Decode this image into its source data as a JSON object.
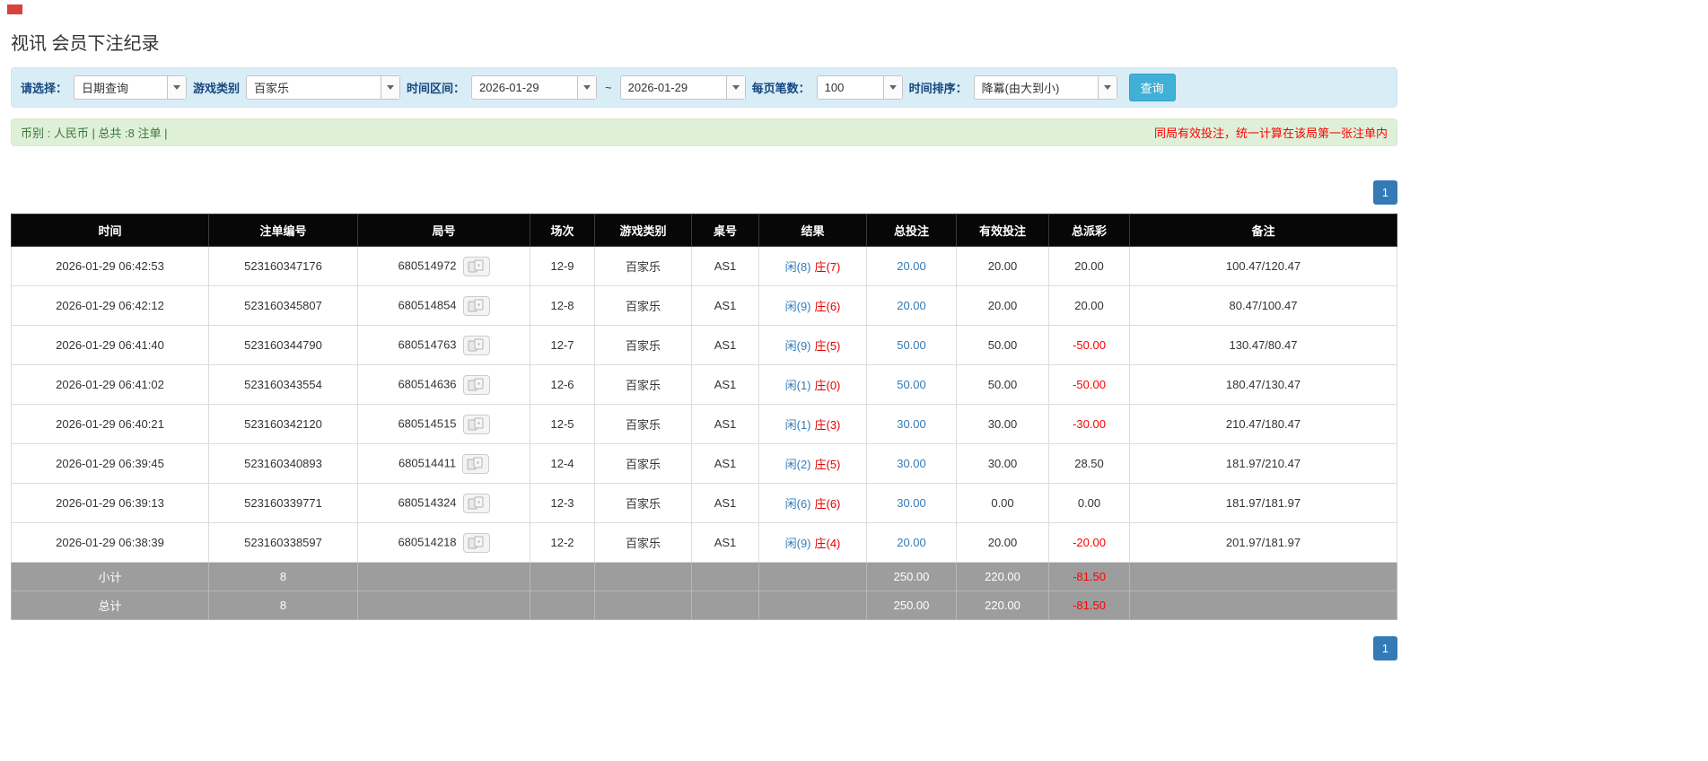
{
  "page": {
    "title": "视讯 会员下注纪录"
  },
  "filters": {
    "select_label": "请选择：",
    "select_value": "日期查询",
    "game_type_label": "游戏类别",
    "game_type_value": "百家乐",
    "date_range_label": "时间区间：",
    "date_from": "2026-01-29",
    "date_separator": "~",
    "date_to": "2026-01-29",
    "page_size_label": "每页笔数：",
    "page_size_value": "100",
    "sort_label": "时间排序：",
    "sort_value": "降冪(由大到小)",
    "search_button": "查询"
  },
  "summary": {
    "left": "币别 : 人民币 | 总共 :8 注单 |",
    "right": "同局有效投注，统一计算在该局第一张注单内"
  },
  "pagination": {
    "page": "1"
  },
  "colors": {
    "header_bg": "#070707",
    "footer_bg": "#9d9d9d",
    "filter_bg": "#d9edf7",
    "summary_bg": "#dff0d8",
    "accent_blue": "#337ab7",
    "button_teal": "#41b0d5",
    "player_blue": "#337ab7",
    "banker_red": "#e60000",
    "negative_red": "#ff0000"
  },
  "table": {
    "headers": [
      "时间",
      "注单编号",
      "局号",
      "场次",
      "游戏类别",
      "桌号",
      "结果",
      "总投注",
      "有效投注",
      "总派彩",
      "备注"
    ],
    "rows": [
      {
        "time": "2026-01-29 06:42:53",
        "bet_id": "523160347176",
        "round_id": "680514972",
        "session": "12-9",
        "game": "百家乐",
        "table_no": "AS1",
        "result_player": "闲(8)",
        "result_banker": "庄(7)",
        "total_bet": "20.00",
        "valid_bet": "20.00",
        "payout": "20.00",
        "remark": "100.47/120.47"
      },
      {
        "time": "2026-01-29 06:42:12",
        "bet_id": "523160345807",
        "round_id": "680514854",
        "session": "12-8",
        "game": "百家乐",
        "table_no": "AS1",
        "result_player": "闲(9)",
        "result_banker": "庄(6)",
        "total_bet": "20.00",
        "valid_bet": "20.00",
        "payout": "20.00",
        "remark": "80.47/100.47"
      },
      {
        "time": "2026-01-29 06:41:40",
        "bet_id": "523160344790",
        "round_id": "680514763",
        "session": "12-7",
        "game": "百家乐",
        "table_no": "AS1",
        "result_player": "闲(9)",
        "result_banker": "庄(5)",
        "total_bet": "50.00",
        "valid_bet": "50.00",
        "payout": "-50.00",
        "remark": "130.47/80.47"
      },
      {
        "time": "2026-01-29 06:41:02",
        "bet_id": "523160343554",
        "round_id": "680514636",
        "session": "12-6",
        "game": "百家乐",
        "table_no": "AS1",
        "result_player": "闲(1)",
        "result_banker": "庄(0)",
        "total_bet": "50.00",
        "valid_bet": "50.00",
        "payout": "-50.00",
        "remark": "180.47/130.47"
      },
      {
        "time": "2026-01-29 06:40:21",
        "bet_id": "523160342120",
        "round_id": "680514515",
        "session": "12-5",
        "game": "百家乐",
        "table_no": "AS1",
        "result_player": "闲(1)",
        "result_banker": "庄(3)",
        "total_bet": "30.00",
        "valid_bet": "30.00",
        "payout": "-30.00",
        "remark": "210.47/180.47"
      },
      {
        "time": "2026-01-29 06:39:45",
        "bet_id": "523160340893",
        "round_id": "680514411",
        "session": "12-4",
        "game": "百家乐",
        "table_no": "AS1",
        "result_player": "闲(2)",
        "result_banker": "庄(5)",
        "total_bet": "30.00",
        "valid_bet": "30.00",
        "payout": "28.50",
        "remark": "181.97/210.47"
      },
      {
        "time": "2026-01-29 06:39:13",
        "bet_id": "523160339771",
        "round_id": "680514324",
        "session": "12-3",
        "game": "百家乐",
        "table_no": "AS1",
        "result_player": "闲(6)",
        "result_banker": "庄(6)",
        "total_bet": "30.00",
        "valid_bet": "0.00",
        "payout": "0.00",
        "remark": "181.97/181.97"
      },
      {
        "time": "2026-01-29 06:38:39",
        "bet_id": "523160338597",
        "round_id": "680514218",
        "session": "12-2",
        "game": "百家乐",
        "table_no": "AS1",
        "result_player": "闲(9)",
        "result_banker": "庄(4)",
        "total_bet": "20.00",
        "valid_bet": "20.00",
        "payout": "-20.00",
        "remark": "201.97/181.97"
      }
    ],
    "subtotal": {
      "label": "小计",
      "count": "8",
      "total_bet": "250.00",
      "valid_bet": "220.00",
      "payout": "-81.50"
    },
    "total": {
      "label": "总计",
      "count": "8",
      "total_bet": "250.00",
      "valid_bet": "220.00",
      "payout": "-81.50"
    }
  }
}
